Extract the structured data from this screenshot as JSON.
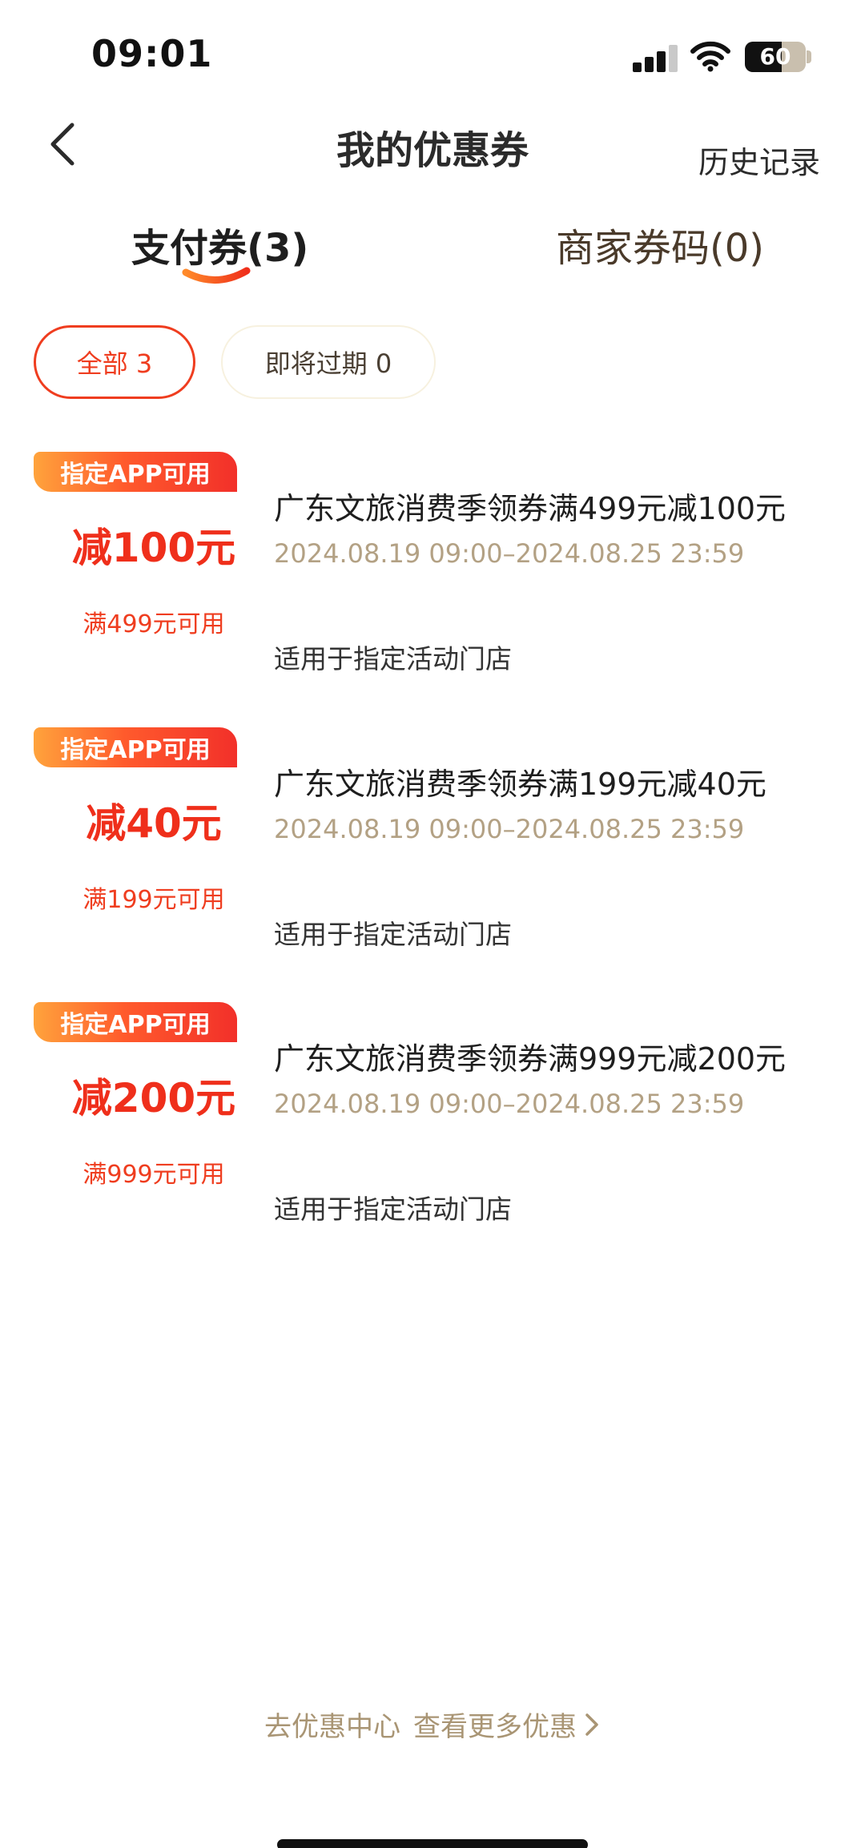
{
  "status_bar": {
    "time": "09:01",
    "battery_level": "60",
    "battery_fraction": 0.6
  },
  "header": {
    "title": "我的优惠券",
    "history_link": "历史记录"
  },
  "tabs": [
    {
      "label": "支付券(3)",
      "active": true
    },
    {
      "label": "商家券码(0)",
      "active": false
    }
  ],
  "filters": [
    {
      "label": "全部 3",
      "active": true
    },
    {
      "label": "即将过期 0",
      "active": false
    }
  ],
  "coupons": [
    {
      "tag": "指定APP可用",
      "amount": "减100元",
      "condition": "满499元可用",
      "title": "广东文旅消费季领券满499元减100元",
      "validity": "2024.08.19 09:00–2024.08.25 23:59",
      "scope": "适用于指定活动门店"
    },
    {
      "tag": "指定APP可用",
      "amount": "减40元",
      "condition": "满199元可用",
      "title": "广东文旅消费季领券满199元减40元",
      "validity": "2024.08.19 09:00–2024.08.25 23:59",
      "scope": "适用于指定活动门店"
    },
    {
      "tag": "指定APP可用",
      "amount": "减200元",
      "condition": "满999元可用",
      "title": "广东文旅消费季领券满999元减200元",
      "validity": "2024.08.19 09:00–2024.08.25 23:59",
      "scope": "适用于指定活动门店"
    }
  ],
  "footer": {
    "link_prefix": "去优惠中心",
    "link_label": "查看更多优惠"
  },
  "colors": {
    "accent": "#ef3d1f",
    "tag_gradient_start": "#ffa33c",
    "tag_gradient_end": "#f2302a",
    "muted_gold": "#b3a184"
  },
  "icons": {
    "back": "chevron-left-icon",
    "more": "chevron-right-icon",
    "signal": "cellular-signal-icon",
    "wifi": "wifi-icon",
    "battery": "battery-icon"
  }
}
